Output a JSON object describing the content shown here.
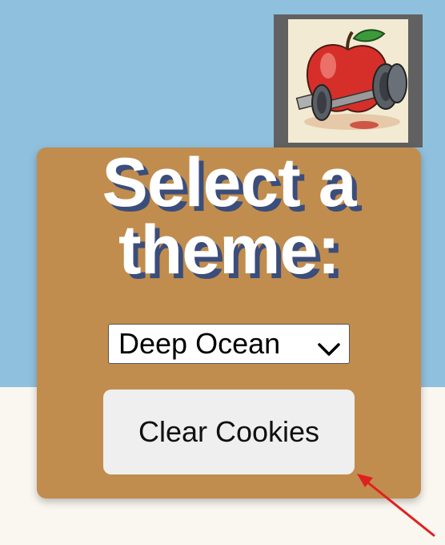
{
  "app": {
    "logo_icon": "apple-dumbbell-logo-icon"
  },
  "panel": {
    "title": "Select a theme:",
    "theme_select": {
      "selected": "Deep Ocean",
      "icon": "chevron-down-icon"
    },
    "clear_button": {
      "label": "Clear Cookies"
    }
  },
  "annotation": {
    "icon": "red-arrow-icon",
    "color": "#e02020"
  },
  "colors": {
    "sky": "#8fc0de",
    "ground": "#faf6f0",
    "panel": "#c08d4e",
    "title_shadow": "#3b4d7a"
  }
}
